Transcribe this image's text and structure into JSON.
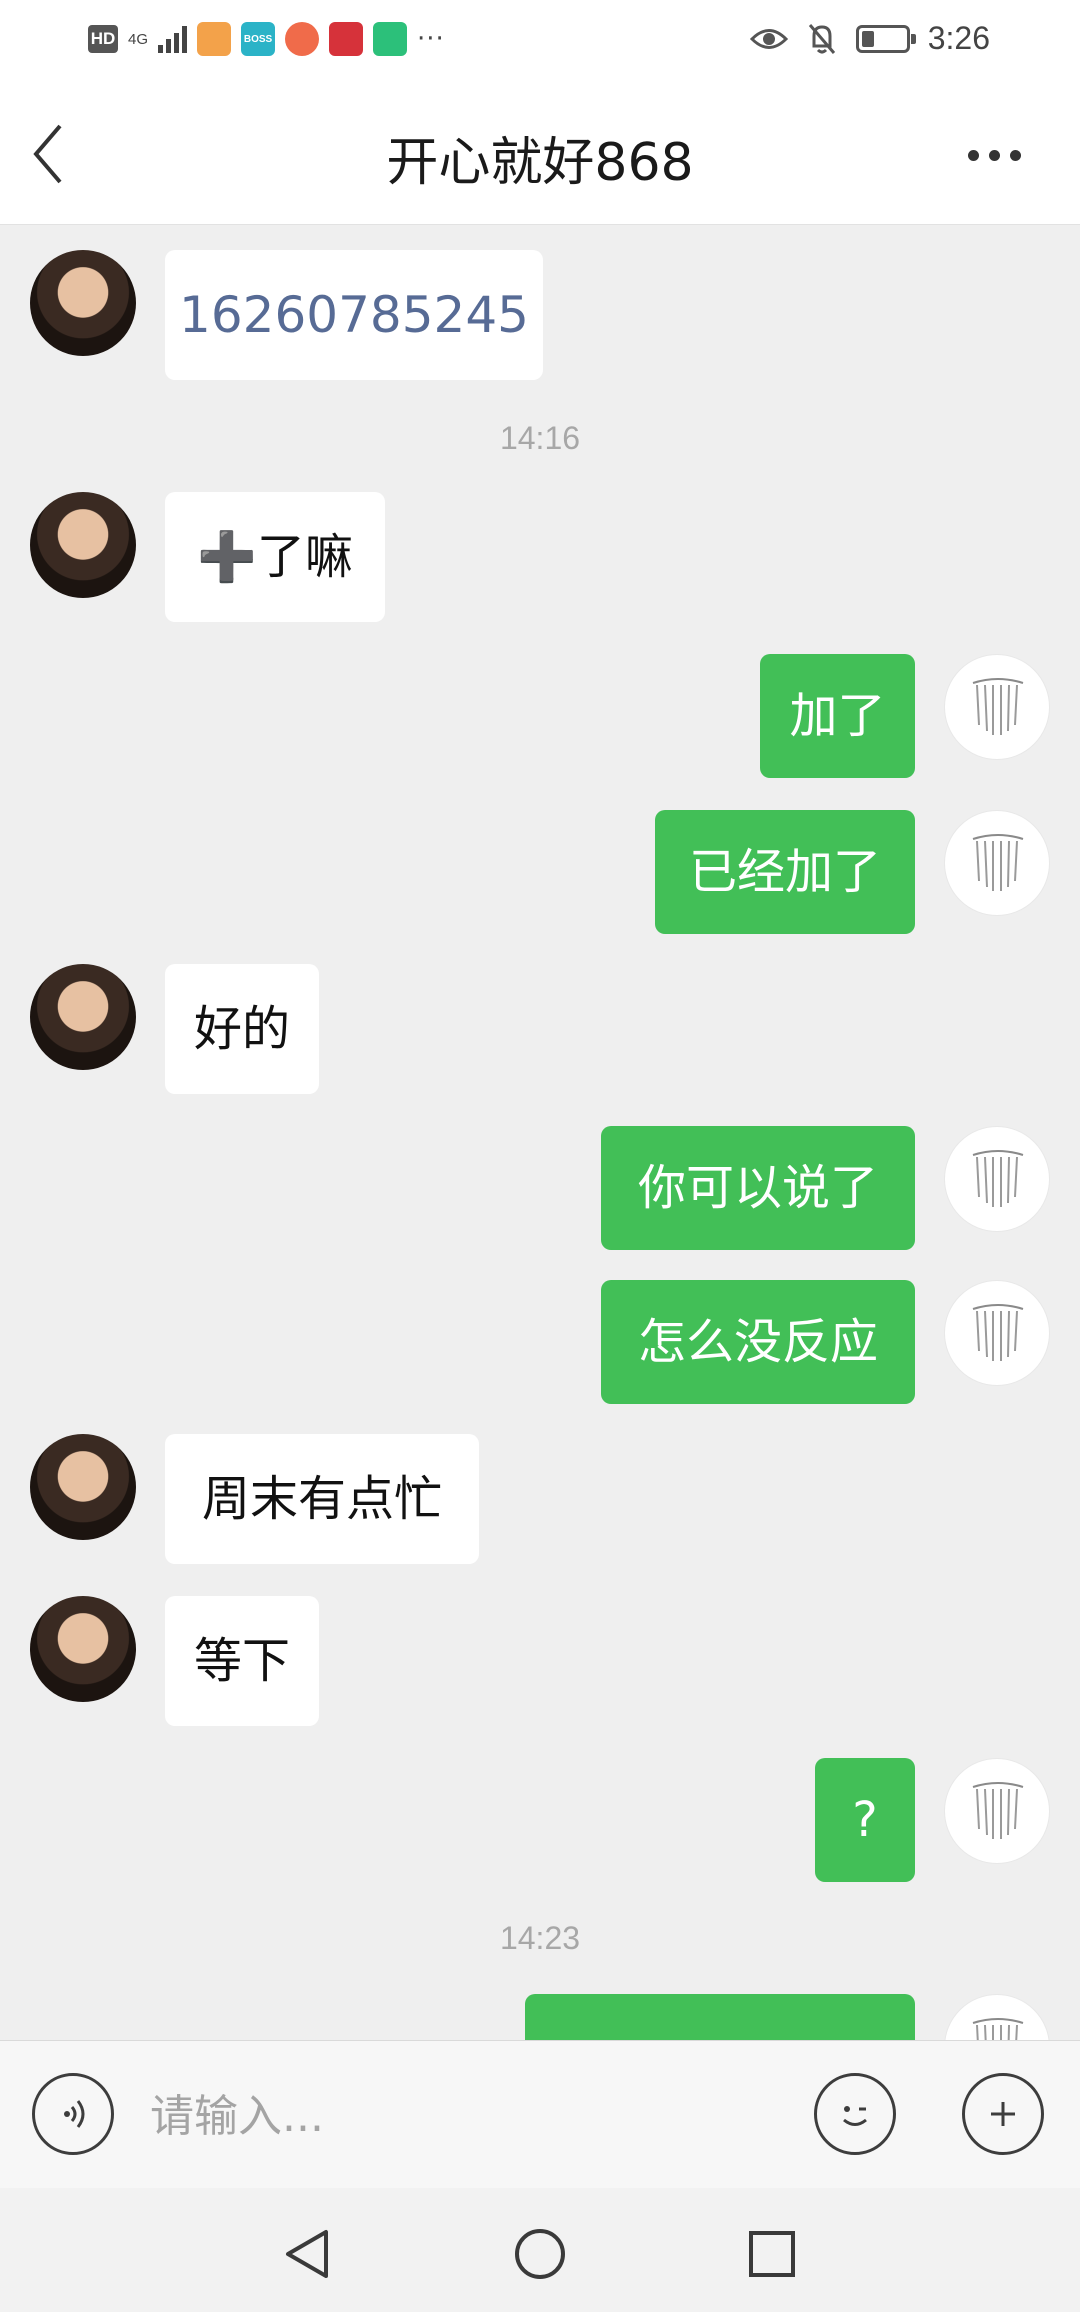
{
  "status_bar": {
    "hd": "HD",
    "network": "4G",
    "boss_label": "BOSS",
    "more": "···",
    "time": "3:26"
  },
  "header": {
    "title": "开心就好868"
  },
  "messages": [
    {
      "sender": "contact",
      "text": "16260785245",
      "kind": "number"
    },
    {
      "timestamp": "14:16"
    },
    {
      "sender": "contact",
      "text": "➕了嘛"
    },
    {
      "sender": "me",
      "text": "加了"
    },
    {
      "sender": "me",
      "text": "已经加了"
    },
    {
      "sender": "contact",
      "text": "好的"
    },
    {
      "sender": "me",
      "text": "你可以说了"
    },
    {
      "sender": "me",
      "text": "怎么没反应"
    },
    {
      "sender": "contact",
      "text": "周末有点忙"
    },
    {
      "sender": "contact",
      "text": "等下"
    },
    {
      "sender": "me",
      "text": "?"
    },
    {
      "timestamp": "14:23"
    },
    {
      "sender": "me",
      "text": ""
    }
  ],
  "input": {
    "placeholder": "请输入..."
  },
  "colors": {
    "outgoing_bubble": "#42bf57",
    "incoming_bubble": "#ffffff",
    "chat_background": "#efefef",
    "number_link": "#576b95"
  },
  "icons": {
    "back": "chevron-left-icon",
    "more": "more-horizontal-icon",
    "voice": "voice-icon",
    "emoji": "emoji-icon",
    "plus": "plus-icon"
  }
}
